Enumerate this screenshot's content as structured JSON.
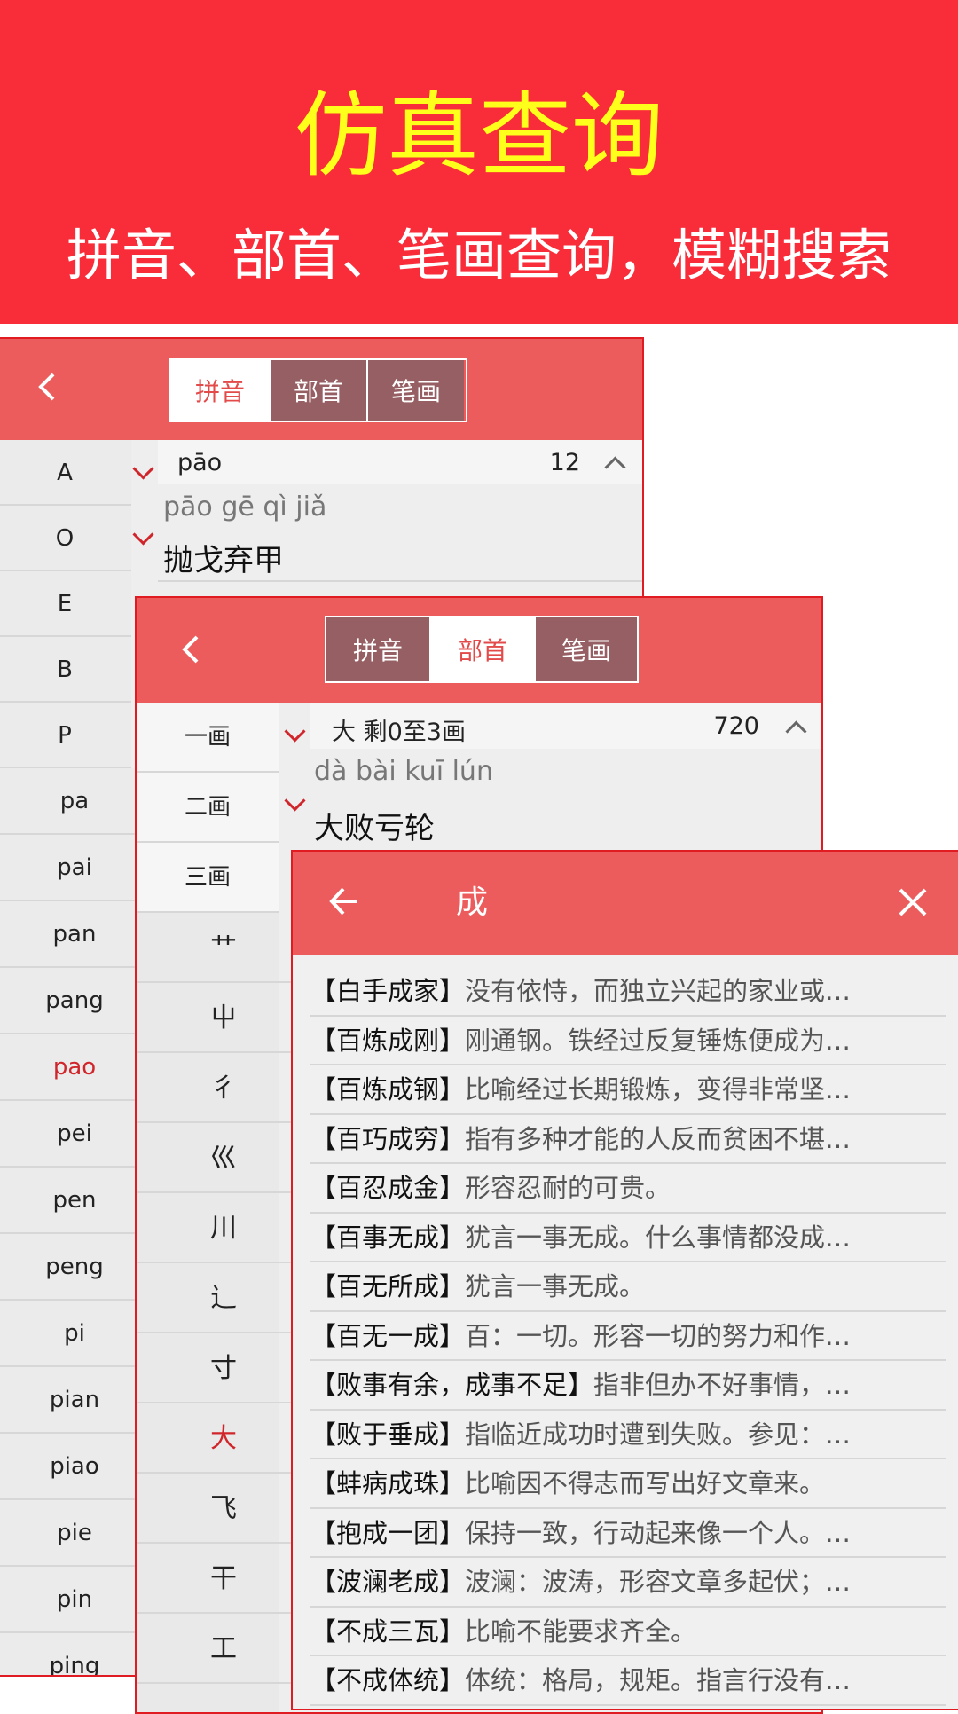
{
  "banner": {
    "title": "仿真查询",
    "subtitle": "拼音、部首、笔画查询，模糊搜索",
    "bg_color": "#f92c39",
    "title_color": "#ffff1c"
  },
  "tabs": [
    "拼音",
    "部首",
    "笔画"
  ],
  "panel_pinyin": {
    "active_tab": "拼音",
    "letters": [
      "A",
      "O",
      "E",
      "B",
      "P"
    ],
    "syllables": [
      "pa",
      "pai",
      "pan",
      "pang",
      "pao",
      "pei",
      "pen",
      "peng",
      "pi",
      "pian",
      "piao",
      "pie",
      "pin",
      "ping"
    ],
    "selected_syllable": "pao",
    "group_title": "pāo",
    "group_count": "12",
    "first_pinyin": "pāo gē qì jiǎ",
    "first_idiom": "抛戈弃甲"
  },
  "panel_radical": {
    "active_tab": "部首",
    "strokes": [
      "一画",
      "二画",
      "三画"
    ],
    "radicals": [
      "艹",
      "屮",
      "彳",
      "巛",
      "川",
      "辶",
      "寸",
      "大",
      "飞",
      "干",
      "工"
    ],
    "selected_radical": "大",
    "group_title": "大 剩0至3画",
    "group_count": "720",
    "first_pinyin": "dà bài kuī lún",
    "first_idiom": "大败亏轮"
  },
  "search_panel": {
    "query": "成",
    "results": [
      {
        "word": "【白手成家】",
        "desc": "没有依恃，而独立兴起的家业或…"
      },
      {
        "word": "【百炼成刚】",
        "desc": "刚通钢。铁经过反复锤炼便成为…"
      },
      {
        "word": "【百炼成钢】",
        "desc": "比喻经过长期锻炼，变得非常坚…"
      },
      {
        "word": "【百巧成穷】",
        "desc": "指有多种才能的人反而贫困不堪…"
      },
      {
        "word": "【百忍成金】",
        "desc": "形容忍耐的可贵。"
      },
      {
        "word": "【百事无成】",
        "desc": "犹言一事无成。什么事情都没成…"
      },
      {
        "word": "【百无所成】",
        "desc": "犹言一事无成。"
      },
      {
        "word": "【百无一成】",
        "desc": "百：一切。形容一切的努力和作…"
      },
      {
        "word": "【败事有余，成事不足】",
        "desc": "指非但办不好事情，…"
      },
      {
        "word": "【败于垂成】",
        "desc": "指临近成功时遭到失败。参见：…"
      },
      {
        "word": "【蚌病成珠】",
        "desc": "比喻因不得志而写出好文章来。"
      },
      {
        "word": "【抱成一团】",
        "desc": "保持一致，行动起来像一个人。…"
      },
      {
        "word": "【波澜老成】",
        "desc": "波澜：波涛，形容文章多起伏；…"
      },
      {
        "word": "【不成三瓦】",
        "desc": "比喻不能要求齐全。"
      },
      {
        "word": "【不成体统】",
        "desc": "体统：格局，规矩。指言行没有…"
      }
    ]
  }
}
